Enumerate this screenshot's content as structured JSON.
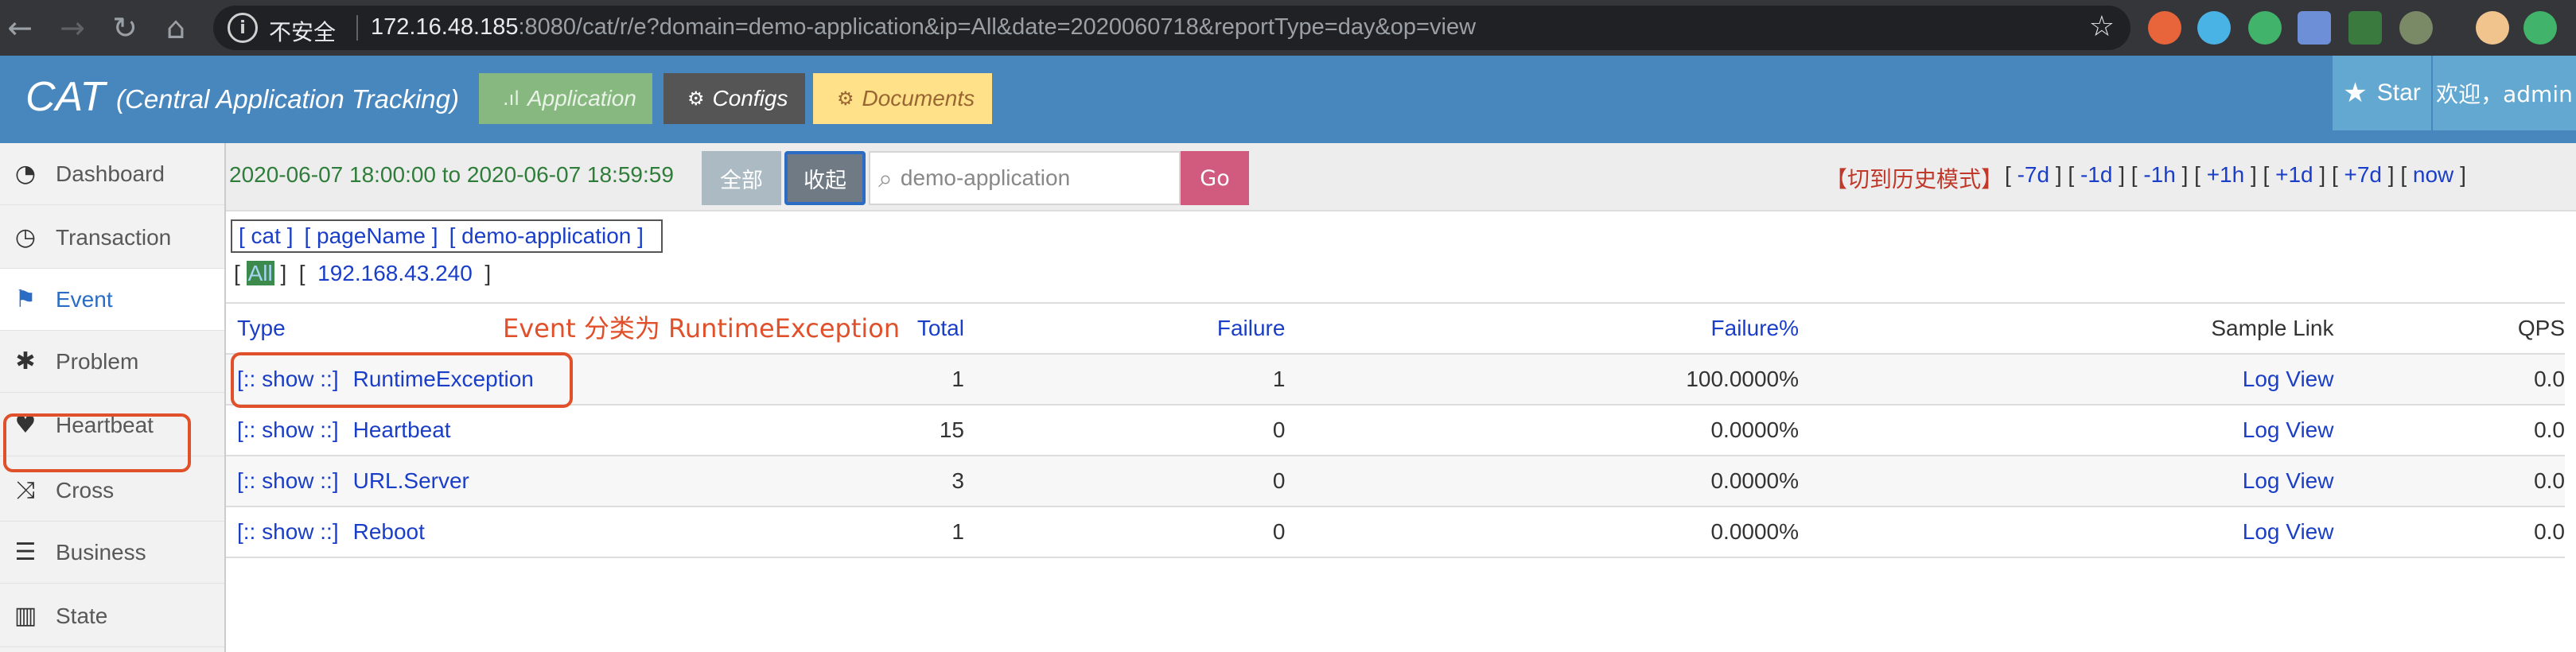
{
  "browser": {
    "insecure_label": "不安全",
    "url_host": "172.16.48.185",
    "url_rest": ":8080/cat/r/e?domain=demo-application&ip=All&date=2020060718&reportType=day&op=view"
  },
  "header": {
    "brand": "CAT",
    "brand_subtitle": "(Central Application Tracking)",
    "buttons": {
      "application": "Application",
      "configs": "Configs",
      "documents": "Documents"
    },
    "star_label": "Star",
    "welcome": "欢迎，admin"
  },
  "sidebar": {
    "items": [
      {
        "label": "Dashboard",
        "icon": "dashboard-icon"
      },
      {
        "label": "Transaction",
        "icon": "clock-icon"
      },
      {
        "label": "Event",
        "icon": "flag-icon"
      },
      {
        "label": "Problem",
        "icon": "bug-icon"
      },
      {
        "label": "Heartbeat",
        "icon": "heart-icon"
      },
      {
        "label": "Cross",
        "icon": "shuffle-icon"
      },
      {
        "label": "Business",
        "icon": "list-icon"
      },
      {
        "label": "State",
        "icon": "bar-chart-icon"
      }
    ],
    "active": "Event"
  },
  "toolbar": {
    "date_range": "2020-06-07 18:00:00 to 2020-06-07 18:59:59",
    "all_button": "全部",
    "collapse_button": "收起",
    "search_value": "demo-application",
    "go_button": "Go",
    "history_mode": "【切到历史模式】",
    "time_links": [
      "-7d",
      "-1d",
      "-1h",
      "+1h",
      "+1d",
      "+7d",
      "now"
    ]
  },
  "breadcrumb": [
    "[ cat ]",
    "[ pageName ]",
    "[ demo-application ]"
  ],
  "ip_filter": {
    "selected": "All",
    "ip": "192.168.43.240"
  },
  "annotation": "Event 分类为 RuntimeException",
  "table": {
    "headers": {
      "type": "Type",
      "total": "Total",
      "failure": "Failure",
      "failure_pct": "Failure%",
      "sample_link": "Sample Link",
      "qps": "QPS"
    },
    "show_label": "[:: show ::]",
    "log_view_label": "Log View",
    "rows": [
      {
        "name": "RuntimeException",
        "total": "1",
        "failure": "1",
        "failure_pct": "100.0000%",
        "qps": "0.0"
      },
      {
        "name": "Heartbeat",
        "total": "15",
        "failure": "0",
        "failure_pct": "0.0000%",
        "qps": "0.0"
      },
      {
        "name": "URL.Server",
        "total": "3",
        "failure": "0",
        "failure_pct": "0.0000%",
        "qps": "0.0"
      },
      {
        "name": "Reboot",
        "total": "1",
        "failure": "0",
        "failure_pct": "0.0000%",
        "qps": "0.0"
      }
    ]
  },
  "colors": {
    "header_blue": "#4887be",
    "annotation_red": "#e0502a",
    "link_blue": "#1a3ec8",
    "date_green": "#2f7d3a",
    "go_pink": "#d15b7e"
  }
}
